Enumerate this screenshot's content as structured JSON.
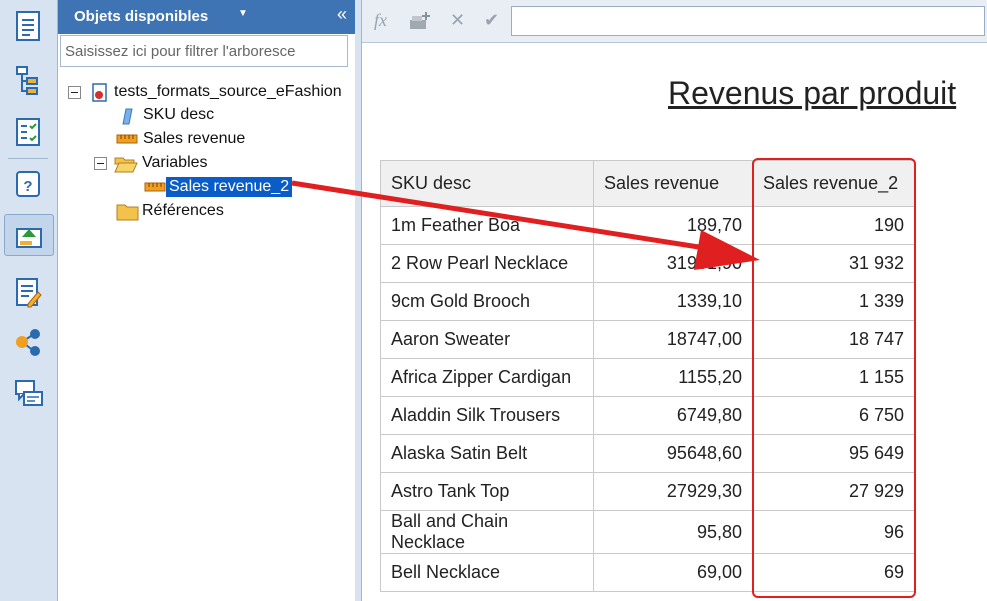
{
  "panel": {
    "title": "Objets disponibles",
    "filter_placeholder": "Saisissez ici pour filtrer l'arboresce",
    "tree": {
      "root": "tests_formats_source_eFashion",
      "items": [
        "SKU desc",
        "Sales revenue"
      ],
      "variables_folder": "Variables",
      "selected_variable": "Sales revenue_2",
      "references_folder": "Références"
    }
  },
  "formula": {
    "fx_label": "fx",
    "value": ""
  },
  "report": {
    "title": "Revenus par produit",
    "headers": [
      "SKU desc",
      "Sales revenue",
      "Sales revenue_2"
    ],
    "rows": [
      [
        "1m Feather Boa",
        "189,70",
        "190"
      ],
      [
        "2 Row Pearl Necklace",
        "31931,90",
        "31 932"
      ],
      [
        "9cm Gold Brooch",
        "1339,10",
        "1 339"
      ],
      [
        "Aaron Sweater",
        "18747,00",
        "18 747"
      ],
      [
        "Africa Zipper Cardigan",
        "1155,20",
        "1 155"
      ],
      [
        "Aladdin Silk Trousers",
        "6749,80",
        "6 750"
      ],
      [
        "Alaska Satin Belt",
        "95648,60",
        "95 649"
      ],
      [
        "Astro Tank Top",
        "27929,30",
        "27 929"
      ],
      [
        "Ball and Chain Necklace",
        "95,80",
        "96"
      ],
      [
        "Bell Necklace",
        "69,00",
        "69"
      ]
    ]
  },
  "colors": {
    "header": "#3e74b3",
    "selection": "#0a5dc7",
    "annotation": "#e02020"
  }
}
